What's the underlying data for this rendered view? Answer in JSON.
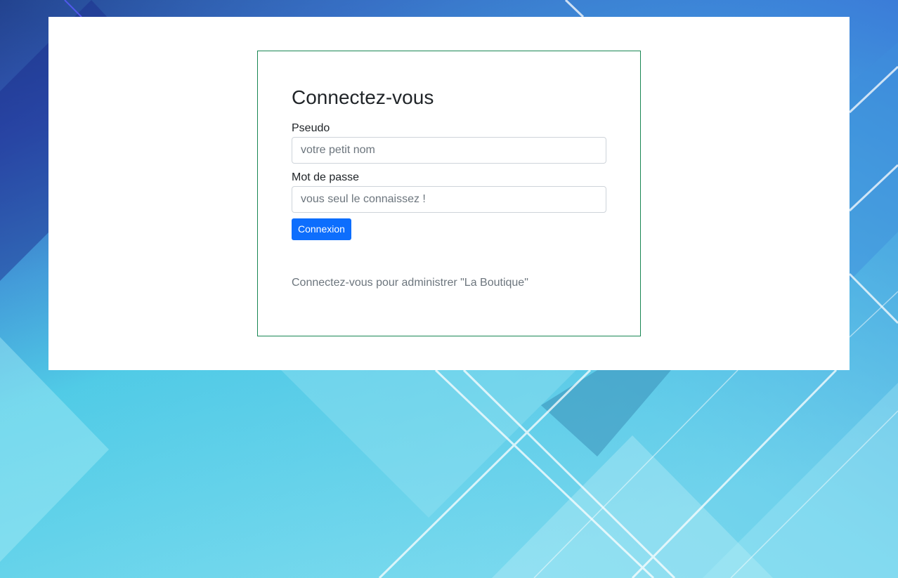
{
  "login": {
    "title": "Connectez-vous",
    "pseudo_label": "Pseudo",
    "pseudo_placeholder": "votre petit nom",
    "password_label": "Mot de passe",
    "password_placeholder": "vous seul le connaissez !",
    "submit_label": "Connexion",
    "help_text": "Connectez-vous pour administrer \"La Boutique\""
  },
  "colors": {
    "card_border": "#198754",
    "button_primary": "#0d6efd",
    "background_dark": "#1a1473",
    "background_light": "#5fd3e8"
  }
}
